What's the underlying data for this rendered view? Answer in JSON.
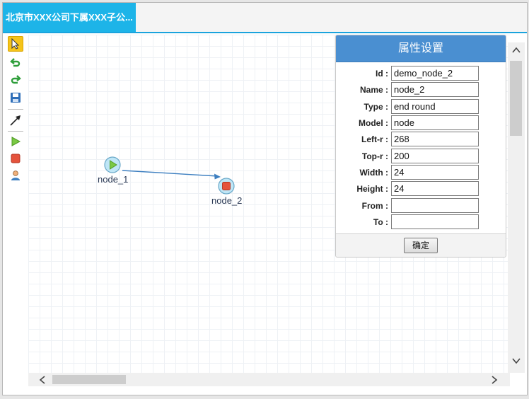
{
  "tabs": [
    {
      "label": "北京市XXX公司下属XXX子公..."
    }
  ],
  "toolbar": {
    "tools": [
      {
        "icon": "select-pointer-icon",
        "active": true
      },
      {
        "icon": "undo-icon"
      },
      {
        "icon": "redo-icon"
      },
      {
        "icon": "save-icon"
      },
      {
        "icon": "transition-line-icon"
      },
      {
        "icon": "start-node-icon"
      },
      {
        "icon": "end-node-icon"
      },
      {
        "icon": "task-user-icon"
      }
    ]
  },
  "canvas": {
    "nodes": [
      {
        "id": "node_1",
        "label": "node_1",
        "kind": "start"
      },
      {
        "id": "node_2",
        "label": "node_2",
        "kind": "end round"
      }
    ]
  },
  "properties": {
    "title": "属性设置",
    "fields": [
      {
        "label": "Id :",
        "value": "demo_node_2"
      },
      {
        "label": "Name :",
        "value": "node_2"
      },
      {
        "label": "Type :",
        "value": "end round"
      },
      {
        "label": "Model :",
        "value": "node"
      },
      {
        "label": "Left-r :",
        "value": "268"
      },
      {
        "label": "Top-r :",
        "value": "200"
      },
      {
        "label": "Width :",
        "value": "24"
      },
      {
        "label": "Height :",
        "value": "24"
      },
      {
        "label": "From :",
        "value": ""
      },
      {
        "label": "To :",
        "value": ""
      }
    ],
    "ok_label": "确定"
  },
  "colors": {
    "tab_bg": "#1db4e8",
    "panel_header": "#4a8fd1",
    "connector": "#3d7fc0",
    "start_node": "#7ac943",
    "end_node": "#e5533c"
  }
}
